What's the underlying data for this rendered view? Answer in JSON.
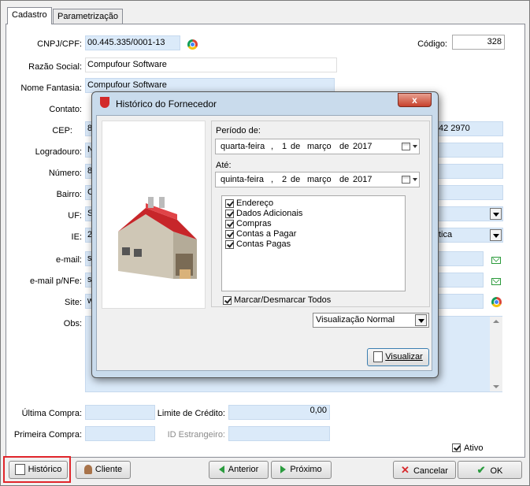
{
  "tabs": [
    "Cadastro",
    "Parametrização"
  ],
  "form": {
    "cnpj_label": "CNPJ/CPF:",
    "cnpj_value": "00.445.335/0001-13",
    "codigo_label": "Código:",
    "codigo_value": "328",
    "razao_label": "Razão Social:",
    "razao_value": "Compufour Software",
    "fantasia_label": "Nome Fantasia:",
    "fantasia_value": "Compufour Software",
    "contato_label": "Contato:",
    "cep_label": "CEP:",
    "cep_value": "8",
    "phone_partial": "42 2970",
    "logradouro_label": "Logradouro:",
    "logradouro_value": "N",
    "numero_label": "Número:",
    "numero_value": "8",
    "bairro_label": "Bairro:",
    "bairro_value": "C",
    "uf_label": "UF:",
    "uf_value": "S",
    "ie_label": "IE:",
    "ie_value": "2",
    "ie_right_partial": "tica",
    "email_label": "e-mail:",
    "email_value": "s",
    "email_nfe_label": "e-mail p/NFe:",
    "email_nfe_value": "s",
    "site_label": "Site:",
    "site_value": "w",
    "obs_label": "Obs:",
    "ultima_label": "Última Compra:",
    "limite_label": "Limite de Crédito:",
    "limite_value": "0,00",
    "primeira_label": "Primeira Compra:",
    "id_estr_label": "ID Estrangeiro:",
    "ativo_label": "Ativo"
  },
  "buttons": {
    "historico": "Histórico",
    "cliente": "Cliente",
    "anterior": "Anterior",
    "proximo": "Próximo",
    "cancelar": "Cancelar",
    "ok": "OK"
  },
  "dialog": {
    "title": "Histórico do Fornecedor",
    "close": "x",
    "periodo_label": "Período de:",
    "from": {
      "weekday": "quarta-feira",
      "day": "1",
      "month": "março",
      "year": "2017"
    },
    "ate_label": "Até:",
    "to": {
      "weekday": "quinta-feira",
      "day": "2",
      "month": "março",
      "year": "2017"
    },
    "sep": ",",
    "de": "de",
    "options": [
      "Endereço",
      "Dados Adicionais",
      "Compras",
      "Contas a Pagar",
      "Contas Pagas"
    ],
    "toggle_all": "Marcar/Desmarcar Todos",
    "view_mode": "Visualização Normal",
    "view_button": "Visualizar"
  },
  "colors": {
    "field_bg": "#dbeaf9",
    "highlight": "#e0262b"
  }
}
